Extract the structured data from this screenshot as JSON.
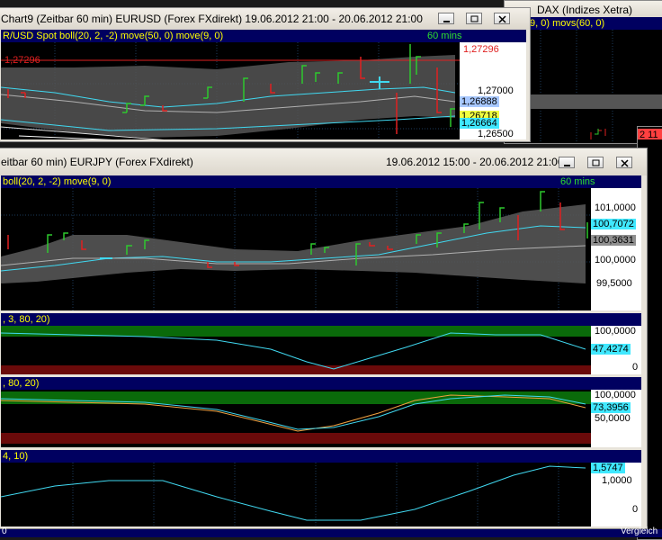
{
  "bg_windows": {
    "dax_title": "DAX (Indizes Xetra)",
    "dax_header": "9, 0) movs(60, 0)",
    "right_partial": "2 11"
  },
  "eurusd": {
    "title": "Chart9 (Zeitbar 60 min)  EURUSD (Forex FXdirekt) 19.06.2012 21:00 - 20.06.2012 21:00",
    "header": "R/USD Spot boll(20, 2, -2) move(50, 0) move(9, 0)",
    "timeframe": "60 mins",
    "ticks": [
      "1,27000",
      "1,26500"
    ],
    "tags": [
      {
        "text": "1,27296",
        "color": "#ff4040"
      },
      {
        "text": "1,26888",
        "color": "#a8c8ff"
      },
      {
        "text": "1,26718",
        "color": "#f0ff40"
      },
      {
        "text": "1,26664",
        "color": "#40e8ff"
      }
    ],
    "hline_label": "1,27296"
  },
  "eurjpy": {
    "title": "eitbar 60 min)  EURJPY (Forex FXdirekt)",
    "date_range": "19.06.2012 15:00 - 20.06.2012 21:00",
    "main_header": "boll(20, 2, -2) move(9, 0)",
    "timeframe": "60 mins",
    "main_ticks": [
      "101,0000",
      "100,0000",
      "99,5000"
    ],
    "main_tags": [
      {
        "text": "100,7072",
        "color": "#40e8ff"
      },
      {
        "text": "100,3631",
        "color": "#909090"
      }
    ],
    "ind1_header": ", 3, 80, 20)",
    "ind1_ticks": [
      "100,0000",
      "0"
    ],
    "ind1_tag": "47,4274",
    "ind2_header": ", 80, 20)",
    "ind2_ticks": [
      "100,0000",
      "50,0000"
    ],
    "ind2_tag": "73,3956",
    "ind3_header": "4, 10)",
    "ind3_ticks": [
      "1,0000",
      "0"
    ],
    "ind3_tag": "1,5747"
  },
  "bottom": {
    "left_text": "0",
    "right_text": "Vergleich"
  },
  "colors": {
    "bull": "#2ec82e",
    "bear": "#e02020",
    "ma_cyan": "#40d8f0",
    "band_fill": "#555555",
    "axis_bg": "#ffffff"
  }
}
